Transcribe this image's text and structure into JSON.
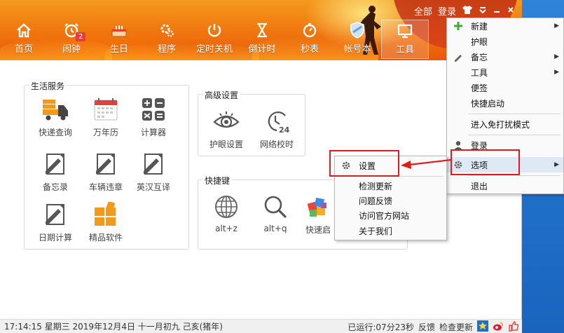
{
  "header": {
    "top_links": {
      "all": "全部",
      "login": "登录"
    },
    "nav": [
      {
        "label": "首页",
        "icon": "home-icon"
      },
      {
        "label": "闹钟",
        "icon": "alarm-clock-icon",
        "badge": "2"
      },
      {
        "label": "生日",
        "icon": "birthday-cake-icon"
      },
      {
        "label": "程序",
        "icon": "gear-icon"
      },
      {
        "label": "定时关机",
        "icon": "power-icon"
      },
      {
        "label": "倒计时",
        "icon": "hourglass-icon"
      },
      {
        "label": "秒表",
        "icon": "stopwatch-icon"
      },
      {
        "label": "帐号本",
        "icon": "shield-icon"
      },
      {
        "label": "工具",
        "icon": "monitor-icon",
        "active": true
      }
    ]
  },
  "groups": {
    "life": {
      "title": "生活服务",
      "tiles": [
        {
          "label": "快递查询",
          "icon": "delivery-truck-icon"
        },
        {
          "label": "万年历",
          "icon": "calendar-icon"
        },
        {
          "label": "计算器",
          "icon": "calculator-icon"
        },
        {
          "label": "备忘录",
          "icon": "memo-pen-icon"
        },
        {
          "label": "车辆违章",
          "icon": "memo-pen-icon"
        },
        {
          "label": "英汉互译",
          "icon": "memo-pen-icon"
        },
        {
          "label": "日期计算",
          "icon": "memo-pen-icon"
        },
        {
          "label": "精品软件",
          "icon": "apps-grid-icon"
        }
      ]
    },
    "advanced": {
      "title": "高级设置",
      "tiles": [
        {
          "label": "护眼设置",
          "icon": "eye-icon"
        },
        {
          "label": "网络校时",
          "icon": "clock-24-icon"
        }
      ]
    },
    "shortcut": {
      "title": "快捷键",
      "tiles": [
        {
          "label": "alt+z",
          "icon": "globe-icon"
        },
        {
          "label": "alt+q",
          "icon": "magnifier-icon"
        },
        {
          "label": "快速启",
          "icon": "colorful-cubes-icon"
        }
      ]
    }
  },
  "main_menu": {
    "items": [
      {
        "label": "新建",
        "icon": "plus-icon",
        "submenu": true
      },
      {
        "label": "护眼"
      },
      {
        "label": "备忘",
        "icon": "pencil-icon",
        "submenu": true
      },
      {
        "label": "工具",
        "submenu": true
      },
      {
        "label": "便签"
      },
      {
        "label": "快捷启动"
      },
      {
        "label": "进入免打扰模式"
      },
      {
        "label": "登录",
        "icon": "user-icon"
      },
      {
        "label": "选项",
        "icon": "gear-icon",
        "submenu": true
      },
      {
        "label": "退出"
      }
    ]
  },
  "options_submenu": {
    "items": [
      {
        "label": "设置",
        "icon": "gear-icon"
      },
      {
        "label": "检测更新"
      },
      {
        "label": "问题反馈"
      },
      {
        "label": "访问官方网站"
      },
      {
        "label": "关于我们"
      }
    ]
  },
  "status": {
    "datetime": "17:14:15  星期三  2019年12月4日  十一月初九  己亥(猪年)",
    "runtime": "已运行:07分23秒",
    "feedback": "反馈",
    "check_update": "检查更新"
  },
  "colors": {
    "banner": "#f17b10",
    "annotation": "#e01b1b",
    "menu_highlight": "#dfe8f5"
  }
}
